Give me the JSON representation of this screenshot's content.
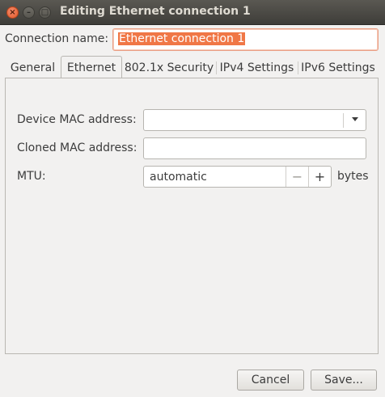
{
  "window": {
    "title": "Editing Ethernet connection 1",
    "close_glyph": "×",
    "min_glyph": "–",
    "max_glyph": "□"
  },
  "connection": {
    "label": "Connection name:",
    "value": "Ethernet connection 1"
  },
  "tabs": [
    {
      "label": "General"
    },
    {
      "label": "Ethernet"
    },
    {
      "label": "802.1x Security"
    },
    {
      "label": "IPv4 Settings"
    },
    {
      "label": "IPv6 Settings"
    }
  ],
  "active_tab": "Ethernet",
  "ethernet": {
    "device_mac_label": "Device MAC address:",
    "device_mac_value": "",
    "cloned_mac_label": "Cloned MAC address:",
    "cloned_mac_value": "",
    "mtu_label": "MTU:",
    "mtu_value": "automatic",
    "mtu_minus": "−",
    "mtu_plus": "+",
    "mtu_unit": "bytes"
  },
  "buttons": {
    "cancel": "Cancel",
    "save": "Save..."
  },
  "colors": {
    "accent": "#f07746",
    "titlebar": "#3e3d39"
  }
}
